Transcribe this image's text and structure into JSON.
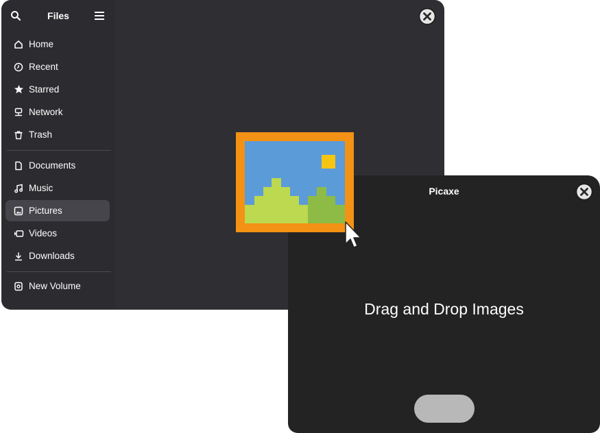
{
  "files": {
    "title": "Files",
    "nav_primary": [
      {
        "label": "Home",
        "icon": "home-icon"
      },
      {
        "label": "Recent",
        "icon": "clock-icon"
      },
      {
        "label": "Starred",
        "icon": "star-icon"
      },
      {
        "label": "Network",
        "icon": "network-icon"
      },
      {
        "label": "Trash",
        "icon": "trash-icon"
      }
    ],
    "nav_places": [
      {
        "label": "Documents",
        "icon": "document-icon"
      },
      {
        "label": "Music",
        "icon": "music-icon"
      },
      {
        "label": "Pictures",
        "icon": "picture-icon",
        "active": true
      },
      {
        "label": "Videos",
        "icon": "video-icon"
      },
      {
        "label": "Downloads",
        "icon": "download-icon"
      }
    ],
    "nav_volumes": [
      {
        "label": "New Volume",
        "icon": "drive-icon"
      }
    ]
  },
  "picaxe": {
    "title": "Picaxe",
    "drop_hint": "Drag and Drop Images",
    "button_label": ""
  },
  "colors": {
    "files_bg": "#2f2f33",
    "picaxe_bg": "#232323",
    "image_frame": "#f39214",
    "image_sky": "#5b9bd8",
    "image_sun": "#f6c512",
    "image_hill": "#bcd94f",
    "image_hill_dark": "#8dbb46"
  }
}
